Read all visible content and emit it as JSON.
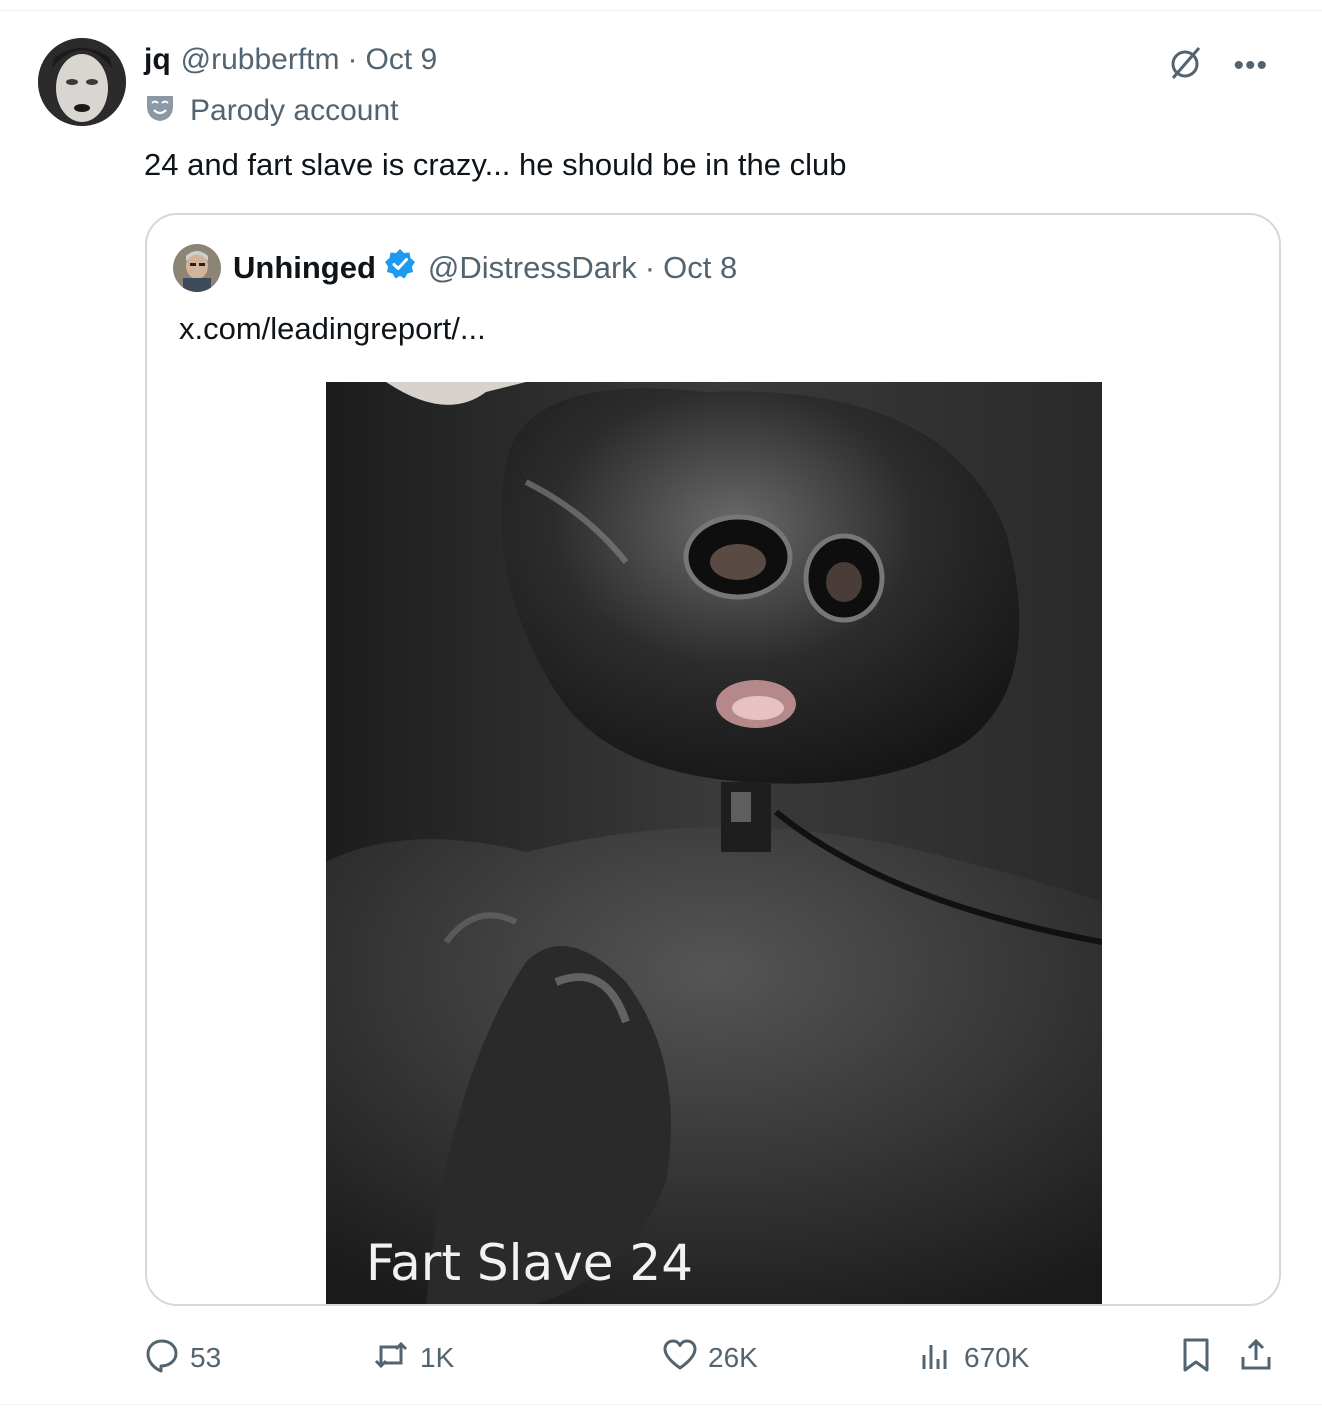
{
  "tweet": {
    "display_name": "jq",
    "handle": "@rubberftm",
    "separator": "·",
    "date": "Oct 9",
    "label": "Parody account",
    "text": "24 and fart slave is crazy... he should be in the club"
  },
  "quoted": {
    "display_name": "Unhinged",
    "handle": "@DistressDark",
    "separator": "·",
    "date": "Oct 8",
    "text": "x.com/leadingreport/...",
    "media_caption": "Fart Slave 24"
  },
  "actions": {
    "replies": "53",
    "reposts": "1K",
    "likes": "26K",
    "views": "670K"
  },
  "colors": {
    "text": "#0f1419",
    "muted": "#536471",
    "border": "#cfd9de",
    "verified": "#1d9bf0"
  },
  "icons": [
    "grok-icon",
    "more-icon",
    "parody-mask-icon",
    "verified-badge-icon",
    "reply-icon",
    "repost-icon",
    "like-icon",
    "views-icon",
    "bookmark-icon",
    "share-icon"
  ]
}
